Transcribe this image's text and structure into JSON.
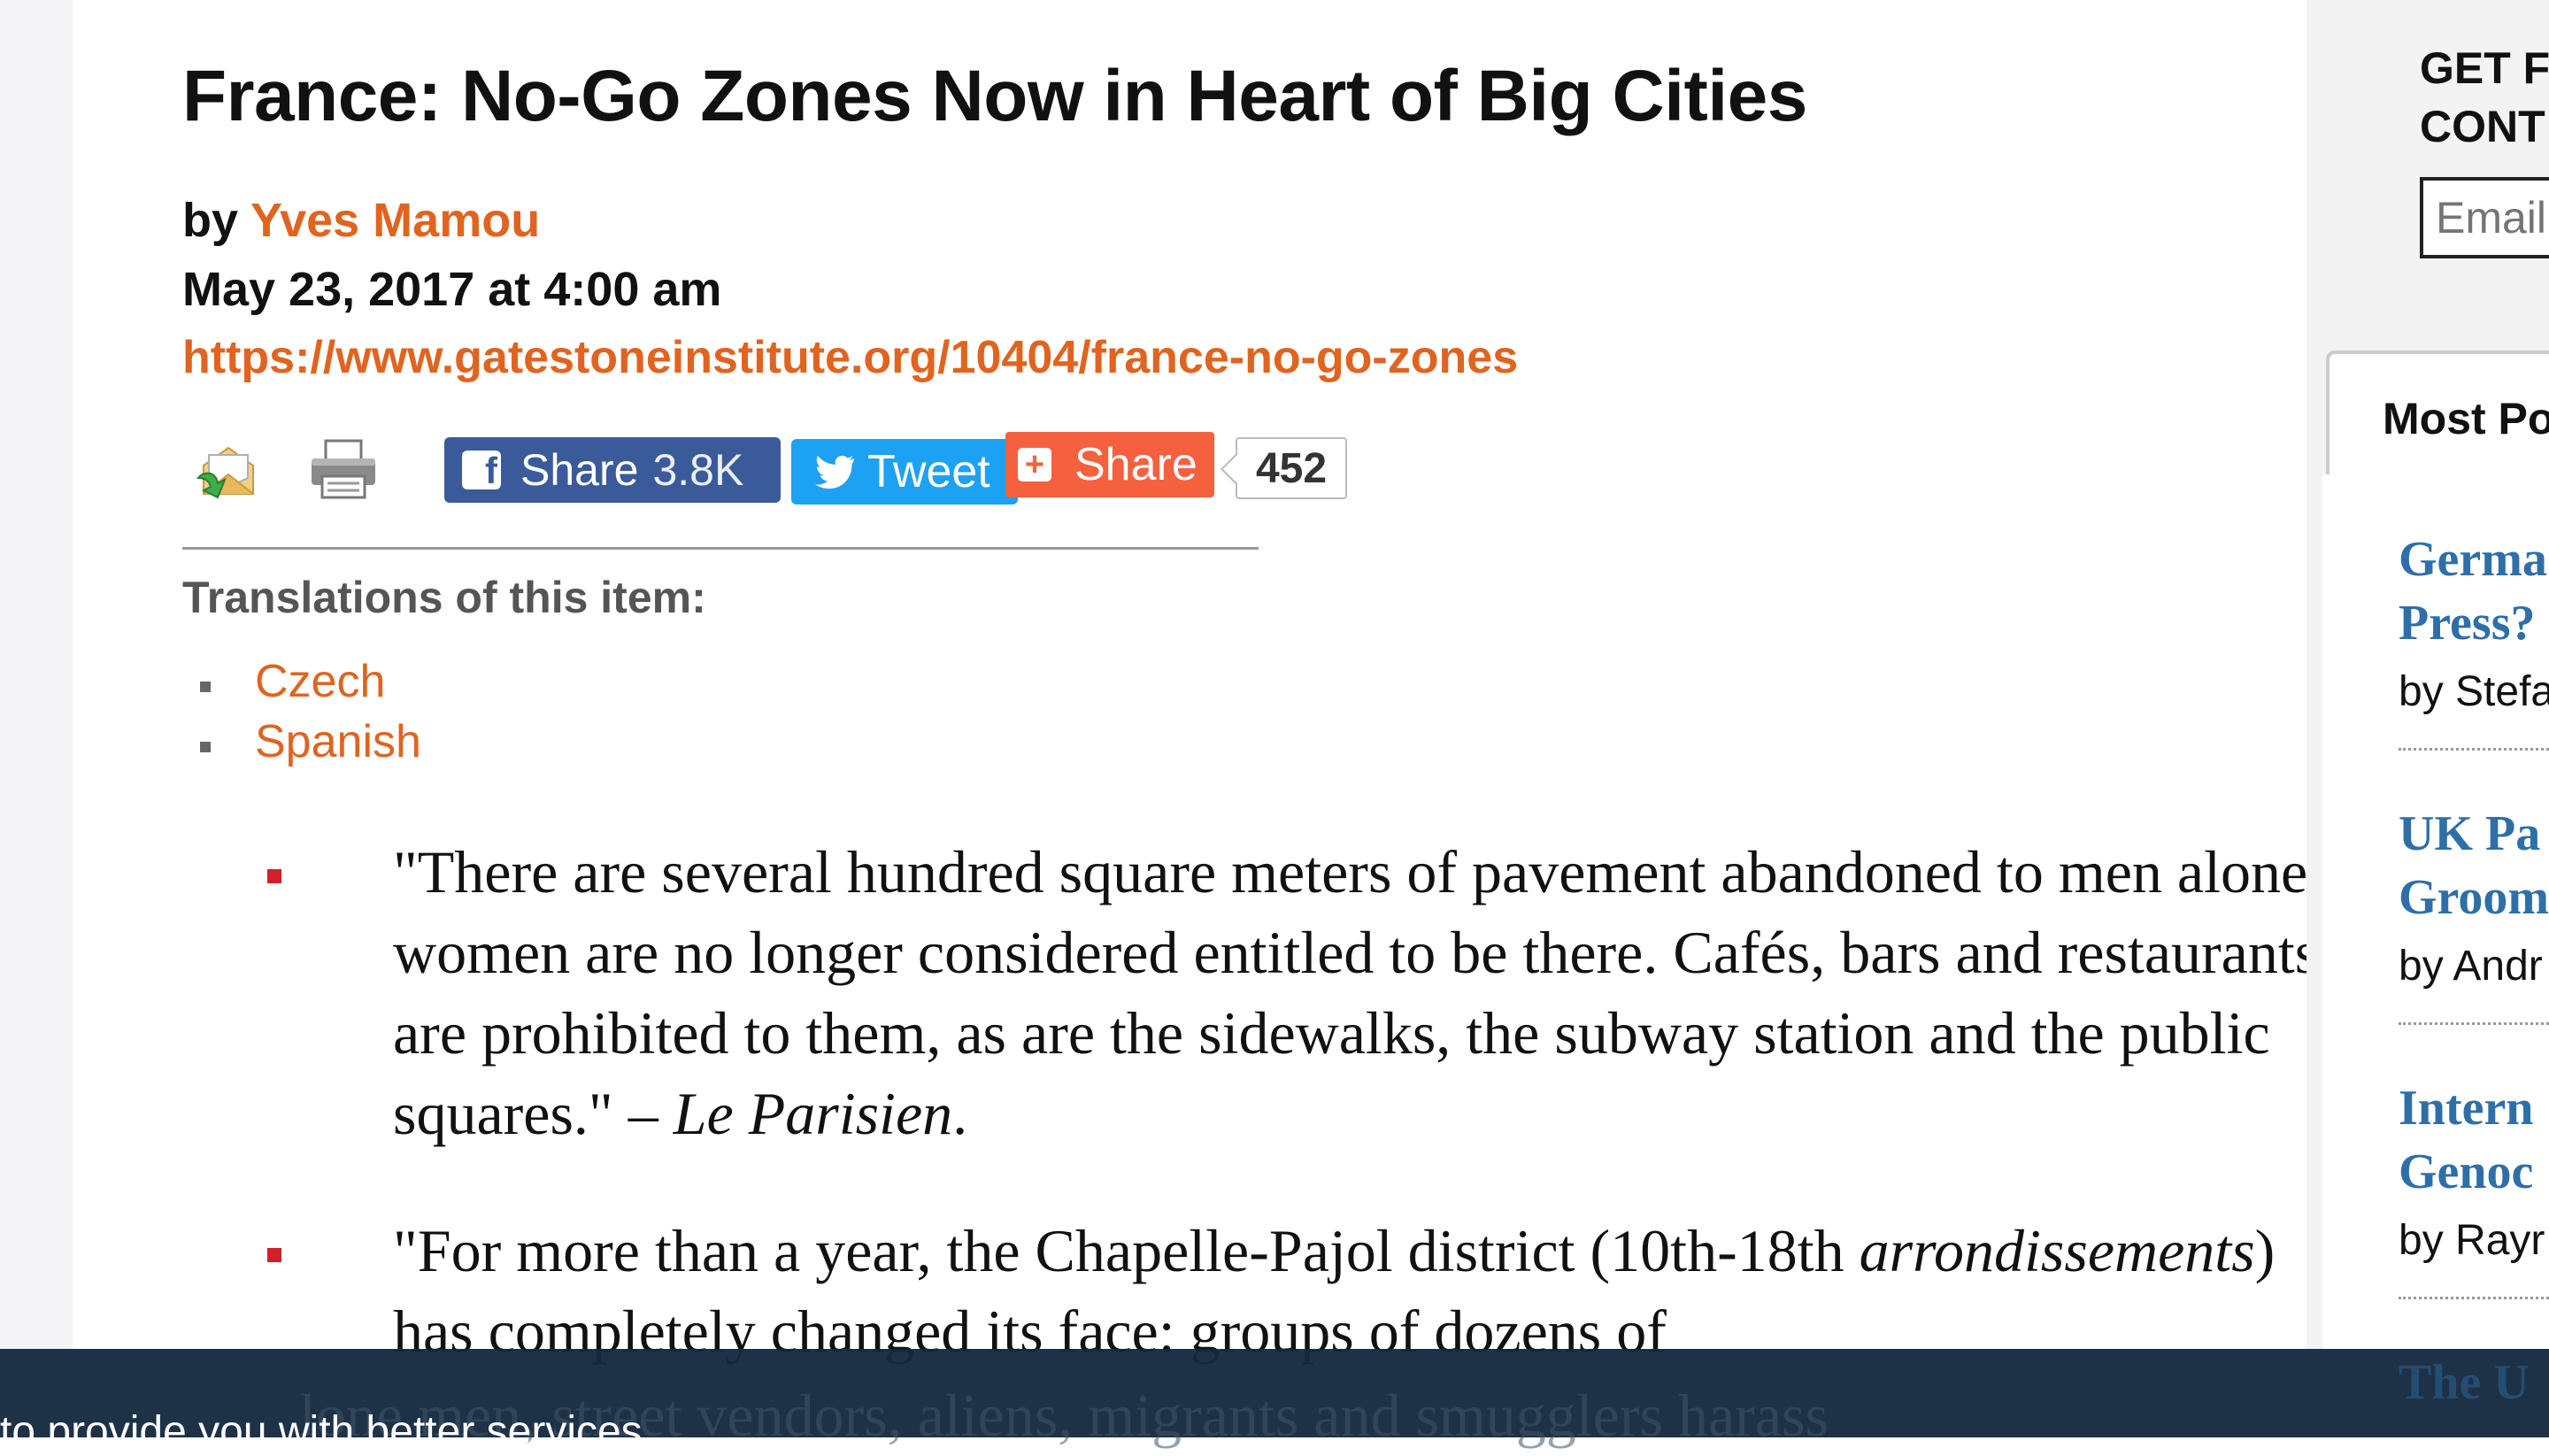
{
  "article": {
    "title": "France: No-Go Zones Now in Heart of Big Cities",
    "by_prefix": "by ",
    "author": "Yves Mamou",
    "date": "May 23, 2017 at 4:00 am",
    "url": "https://www.gatestoneinstitute.org/10404/france-no-go-zones"
  },
  "share": {
    "facebook_label": "Share",
    "facebook_count": "3.8K",
    "twitter_label": "Tweet",
    "addthis_label": "Share",
    "total_count": "452"
  },
  "translations": {
    "label": "Translations of this item:",
    "items": [
      "Czech",
      "Spanish"
    ]
  },
  "quotes": [
    {
      "text": "\"There are several hundred square meters of pavement abandoned to men alone; women are no longer considered entitled to be there. Cafés, bars and restaurants are prohibited to them, as are the sidewalks, the subway station and the public squares.\" – ",
      "source": "Le Parisien",
      "end": "."
    },
    {
      "text_a": "\"For more than a year, the Chapelle-Pajol district (10th-18th ",
      "text_em": "arrondissements",
      "text_b": ") has completely changed its face: groups of dozens of",
      "faded": "lone men, street vendors, aliens, migrants and smugglers harass"
    }
  ],
  "sidebar": {
    "newsletter_line1": "GET F",
    "newsletter_line2": "CONT",
    "email_placeholder": "Email",
    "popular_tab": "Most Po",
    "items": [
      {
        "line1": "Germa",
        "line2": "Press?",
        "by": "by Stefa"
      },
      {
        "line1": "UK Pa",
        "line2": "Groom",
        "by": "by Andr"
      },
      {
        "line1": "Intern",
        "line2": "Genoc",
        "by": "by Rayr"
      },
      {
        "line1": "The U",
        "line2": "",
        "by": ""
      }
    ]
  },
  "cookie": {
    "text": "to provide you with better services."
  },
  "colors": {
    "accent": "#e0641f",
    "facebook": "#3b5a9a",
    "twitter": "#1da1f2",
    "addthis": "#f5603f",
    "sidebar_link": "#2f6fa8",
    "cookie_bar": "#14293f"
  }
}
